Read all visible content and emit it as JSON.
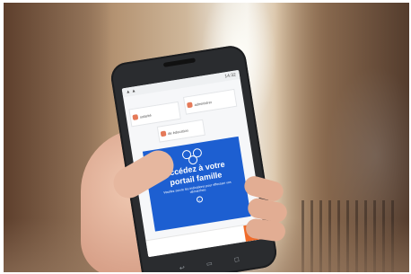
{
  "scene": {
    "subject": "hand holding smartphone",
    "phone_screen": {
      "status_time": "14:32",
      "logo_text": "",
      "tiles": [
        {
          "label": "solarité"
        },
        {
          "label": "administrer"
        },
        {
          "label": "de éducation"
        }
      ],
      "banner": {
        "title_line1": "Accédez à votre",
        "title_line2": "portail famille",
        "subtitle": "Veuillez suivre les indications pour effectuer vos démarches",
        "icon": "family-icon"
      },
      "bottom_button_icon": "plus-icon"
    }
  },
  "colors": {
    "banner_blue": "#1d5fd1",
    "accent_orange": "#f06b2a",
    "phone_body": "#2a2c2f"
  }
}
